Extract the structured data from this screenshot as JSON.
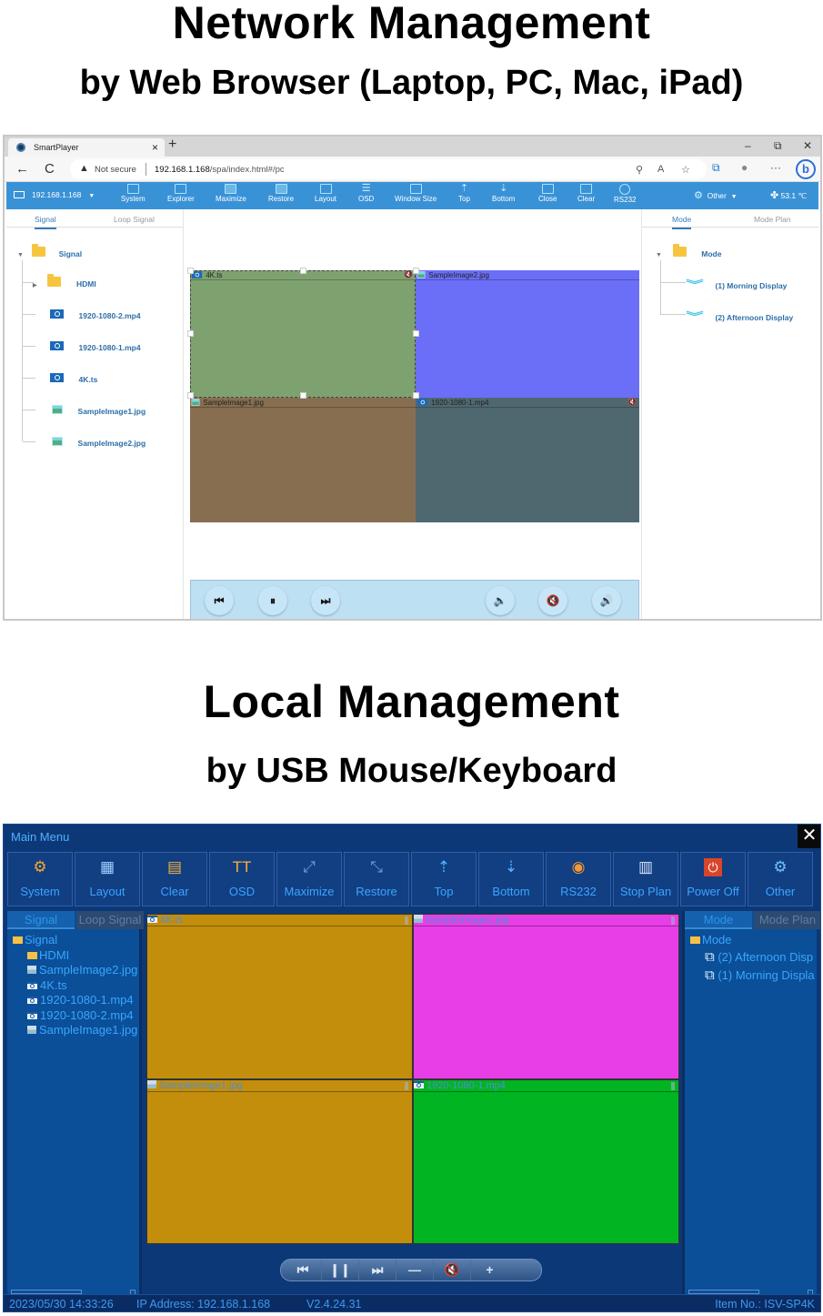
{
  "headings": {
    "network_title": "Network Management",
    "network_subtitle": "by Web Browser (Laptop, PC, Mac, iPad)",
    "local_title": "Local Management",
    "local_subtitle": "by USB Mouse/Keyboard"
  },
  "browser": {
    "tab_title": "SmartPlayer",
    "tab_close": "×",
    "new_tab": "+",
    "window_controls": {
      "minimize": "–",
      "restore": "⧉",
      "close": "✕"
    },
    "security_label": "Not secure",
    "url_host": "192.168.1.168",
    "url_path": "/spa/index.html#/pc",
    "icons": {
      "back": "←",
      "reload": "C",
      "warning": "▲",
      "key": "⚲",
      "read_aloud": "A",
      "favorites": "☆",
      "collections": "⧉",
      "profile": "●",
      "more": "···",
      "bing": "b"
    }
  },
  "web_app": {
    "device": "192.168.1.168",
    "toolbar": [
      {
        "label": "System",
        "icon": "system-icon"
      },
      {
        "label": "Explorer",
        "icon": "explorer-icon"
      },
      {
        "label": "Maximize",
        "icon": "maximize-icon"
      },
      {
        "label": "Restore",
        "icon": "restore-icon"
      },
      {
        "label": "Layout",
        "icon": "layout-icon"
      },
      {
        "label": "OSD",
        "icon": "osd-icon"
      },
      {
        "label": "Window Size",
        "icon": "window-size-icon"
      },
      {
        "label": "Top",
        "icon": "top-icon"
      },
      {
        "label": "Bottom",
        "icon": "bottom-icon"
      },
      {
        "label": "Close",
        "icon": "close-icon"
      },
      {
        "label": "Clear",
        "icon": "clear-icon"
      },
      {
        "label": "RS232",
        "icon": "rs232-icon"
      }
    ],
    "other_label": "Other",
    "temperature": "53.1 ℃",
    "left_panel": {
      "tabs": [
        "Signal",
        "Loop Signal"
      ],
      "root": "Signal",
      "items": [
        {
          "label": "HDMI",
          "type": "folder"
        },
        {
          "label": "1920-1080-2.mp4",
          "type": "video"
        },
        {
          "label": "1920-1080-1.mp4",
          "type": "video"
        },
        {
          "label": "4K.ts",
          "type": "video"
        },
        {
          "label": "SampleImage1.jpg",
          "type": "image"
        },
        {
          "label": "SampleImage2.jpg",
          "type": "image"
        }
      ]
    },
    "right_panel": {
      "tabs": [
        "Mode",
        "Mode Plan"
      ],
      "root": "Mode",
      "items": [
        "(1)   Morning Display",
        "(2)   Afternoon Display"
      ]
    },
    "windows": [
      {
        "title": "4K.ts",
        "type": "video",
        "color": "#7da26f",
        "muted": true,
        "selected": true
      },
      {
        "title": "SampleImage2.jpg",
        "type": "image",
        "color": "#6b6ef7",
        "muted": false,
        "selected": false
      },
      {
        "title": "SampleImage1.jpg",
        "type": "image",
        "color": "#876e50",
        "muted": false,
        "selected": false
      },
      {
        "title": "1920-1080-1.mp4",
        "type": "video",
        "color": "#4f6870",
        "muted": true,
        "selected": false
      }
    ],
    "player_buttons": [
      "⏮",
      "⏸",
      "⏭",
      "🔈",
      "🔇",
      "🔊"
    ]
  },
  "local_app": {
    "title": "Main Menu",
    "close": "✕",
    "menu": [
      {
        "label": "System",
        "icon": "⚙",
        "color": "#f0a830"
      },
      {
        "label": "Layout",
        "icon": "▦",
        "color": "#9fd0ff"
      },
      {
        "label": "Clear",
        "icon": "▤",
        "color": "#f5b23c"
      },
      {
        "label": "OSD",
        "icon": "TT",
        "color": "#f5b23c"
      },
      {
        "label": "Maximize",
        "icon": "⤢",
        "color": "#6fa0d8"
      },
      {
        "label": "Restore",
        "icon": "⤡",
        "color": "#6fa0d8"
      },
      {
        "label": "Top",
        "icon": "⇡",
        "color": "#4fb6ff"
      },
      {
        "label": "Bottom",
        "icon": "⇣",
        "color": "#4fb6ff"
      },
      {
        "label": "RS232",
        "icon": "◉",
        "color": "#f59a30"
      },
      {
        "label": "Stop Plan",
        "icon": "▥",
        "color": "#dce8ff"
      },
      {
        "label": "Power Off",
        "icon": "⏻",
        "color": "#ffffff"
      },
      {
        "label": "Other",
        "icon": "⚙",
        "color": "#6fc0ff"
      }
    ],
    "left_panel": {
      "tabs": [
        "Signal",
        "Loop Signal"
      ],
      "root": "Signal",
      "items": [
        {
          "label": "HDMI",
          "type": "folder"
        },
        {
          "label": "SampleImage2.jpg",
          "type": "image"
        },
        {
          "label": "4K.ts",
          "type": "video"
        },
        {
          "label": "1920-1080-1.mp4",
          "type": "video"
        },
        {
          "label": "1920-1080-2.mp4",
          "type": "video"
        },
        {
          "label": "SampleImage1.jpg",
          "type": "image"
        }
      ]
    },
    "right_panel": {
      "tabs": [
        "Mode",
        "Mode Plan"
      ],
      "root": "Mode",
      "items": [
        "(2) Afternoon Disp",
        "(1) Morning Displa"
      ]
    },
    "windows": [
      {
        "title": "4K.ts",
        "type": "video",
        "color": "#c28e0c"
      },
      {
        "title": "SampleImage2.jpg",
        "type": "image",
        "color": "#e83ee8"
      },
      {
        "title": "SampleImage1.jpg",
        "type": "image",
        "color": "#c28e0c"
      },
      {
        "title": "1920-1080-1.mp4",
        "type": "video",
        "color": "#00b521"
      }
    ],
    "player_buttons": [
      "⏮",
      "❙❙",
      "⏭",
      "—",
      "🔇",
      "+"
    ],
    "status": {
      "datetime": "2023/05/30 14:33:26",
      "ip": "IP Address: 192.168.1.168",
      "version": "V2.4.24.31",
      "item_no": "Item No.: ISV-SP4K"
    }
  }
}
